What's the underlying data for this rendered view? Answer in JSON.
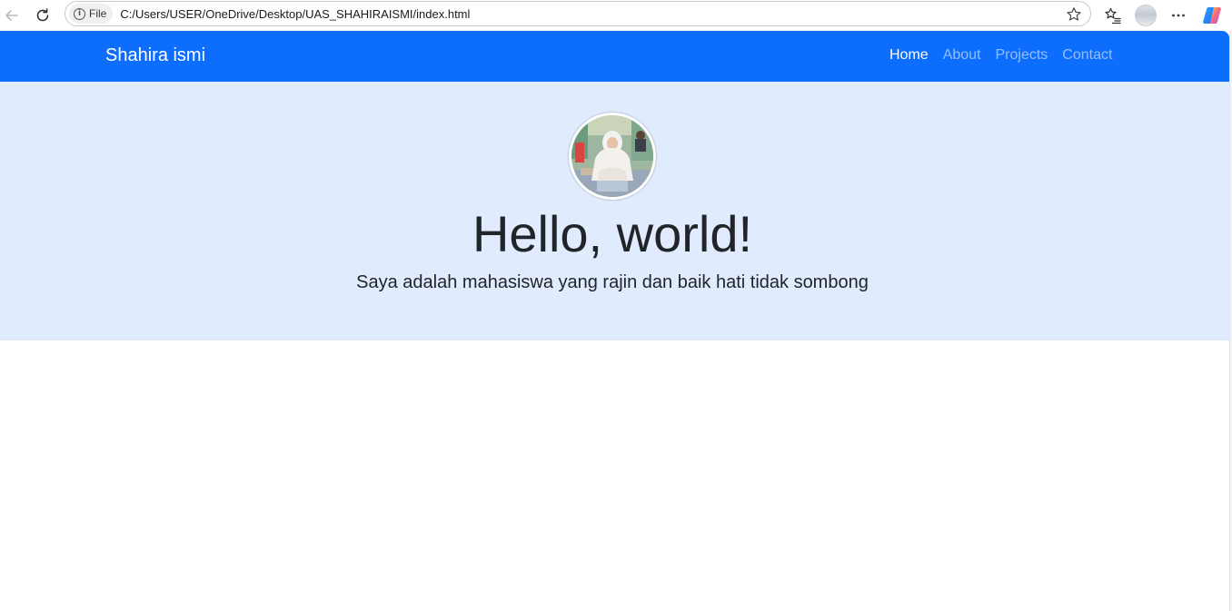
{
  "browser": {
    "site_info_label": "File",
    "url": "C:/Users/USER/OneDrive/Desktop/UAS_SHAHIRAISMI/index.html",
    "icons": [
      "back-icon",
      "reload-icon",
      "info-icon",
      "star-icon",
      "favorites-icon",
      "profile-avatar",
      "more-icon",
      "copilot-icon"
    ]
  },
  "navbar": {
    "brand": "Shahira ismi",
    "links": [
      {
        "label": "Home",
        "active": true
      },
      {
        "label": "About",
        "active": false
      },
      {
        "label": "Projects",
        "active": false
      },
      {
        "label": "Contact",
        "active": false
      }
    ],
    "color": "#0d6efd"
  },
  "hero": {
    "title": "Hello, world!",
    "subtitle": "Saya adalah mahasiswa yang rajin dan baik hati tidak sombong",
    "background": "#e0ebfd"
  }
}
